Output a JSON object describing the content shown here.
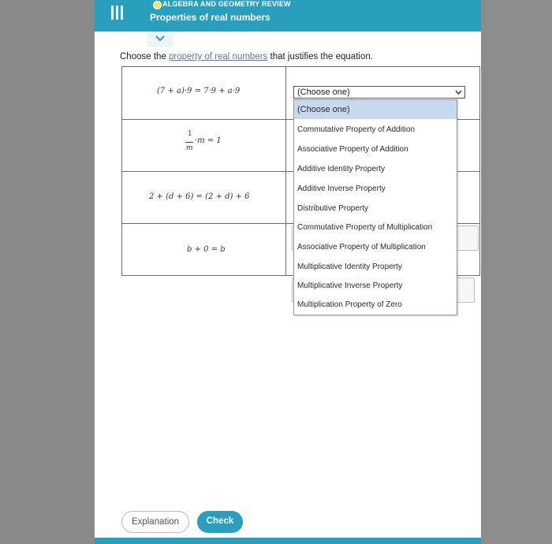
{
  "header": {
    "topic": "ALGEBRA AND GEOMETRY REVIEW",
    "title": "Properties of real numbers"
  },
  "instruction": {
    "before": "Choose the ",
    "link": "property of real numbers",
    "after": " that justifies the equation."
  },
  "equations": [
    {
      "text": "(7 + a)·9 = 7·9 + a·9"
    },
    {
      "numerator": "1",
      "denominator": "m",
      "rest": "·m = 1"
    },
    {
      "text": "2 + (d + 6) = (2 + d) + 6"
    },
    {
      "text": "b + 0 = b"
    }
  ],
  "select": {
    "current": "(Choose one)",
    "options": [
      "(Choose one)",
      "Commutative Property of Addition",
      "Associative Property of Addition",
      "Additive Identity Property",
      "Additive Inverse Property",
      "Distributive Property",
      "Commutative Property of Multiplication",
      "Associative Property of Multiplication",
      "Multiplicative Identity Property",
      "Multiplicative Inverse Property",
      "Multiplication Property of Zero"
    ]
  },
  "buttons": {
    "explanation": "Explanation",
    "check": "Check"
  },
  "colors": {
    "accent": "#2a9ebd",
    "link": "#5f78a8",
    "selected_option": "#c6d9ef"
  }
}
